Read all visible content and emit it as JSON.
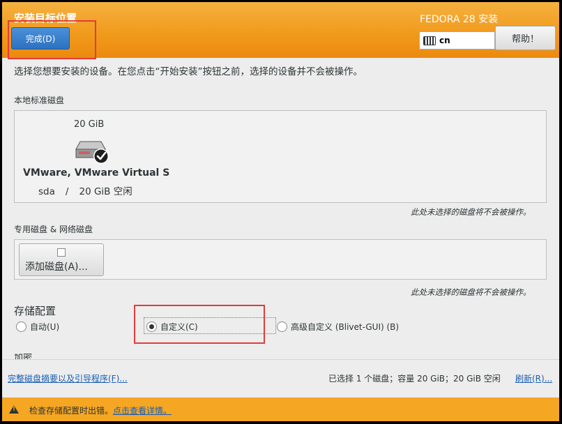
{
  "header": {
    "title": "安装目标位置",
    "done_label": "完成(D)",
    "product": "FEDORA 28 安装",
    "keyboard_layout": "cn",
    "help_label": "帮助！"
  },
  "instruction": "选择您想要安装的设备。在您点击“开始安装”按钮之前，选择的设备并不会被操作。",
  "local_disks": {
    "section_label": "本地标准磁盘",
    "disk": {
      "size": "20 GiB",
      "name": "VMware, VMware Virtual S",
      "device": "sda",
      "separator": "/",
      "free": "20 GiB 空闲",
      "selected": true,
      "icon": "harddisk-checked-icon"
    },
    "note": "此处未选择的磁盘将不会被操作。"
  },
  "special_disks": {
    "section_label": "专用磁盘 & 网络磁盘",
    "add_button_label": "添加磁盘(A)...",
    "note": "此处未选择的磁盘将不会被操作。"
  },
  "storage_config": {
    "title": "存储配置",
    "options": [
      {
        "label": "自动(U)",
        "selected": false
      },
      {
        "label": "自定义(C)",
        "selected": true
      },
      {
        "label": "高级自定义 (Blivet-GUI) (B)",
        "selected": false
      }
    ],
    "encryption_label": "加密"
  },
  "footer": {
    "summary_link": "完整磁盘摘要以及引导程序(F)...",
    "selection_summary": "已选择 1 个磁盘；容量 20 GiB；20 GiB 空闲",
    "refresh_link": "刷新(R)..."
  },
  "warning": {
    "text": "检查存储配置时出错。",
    "link": "点击查看详情。"
  },
  "colors": {
    "header": "#f0991a",
    "accent": "#2d72c0",
    "warning": "#f5a623",
    "annotation": "#e23b3b"
  }
}
